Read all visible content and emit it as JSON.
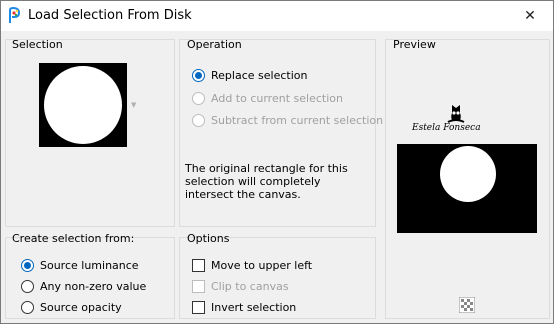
{
  "window": {
    "title": "Load Selection From Disk",
    "icon": "app-icon",
    "close_symbol": "✕"
  },
  "selection": {
    "label": "Selection",
    "dropdown_icon": "chevron-down-icon"
  },
  "operation": {
    "label": "Operation",
    "options": [
      {
        "label": "Replace selection",
        "checked": true,
        "enabled": true
      },
      {
        "label": "Add to current selection",
        "checked": false,
        "enabled": false
      },
      {
        "label": "Subtract from current selection",
        "checked": false,
        "enabled": false
      }
    ],
    "info": "The original rectangle for this selection will completely intersect the canvas."
  },
  "preview": {
    "label": "Preview",
    "watermark": "Estela Fonseca",
    "zoom_icon": "checker-icon"
  },
  "create_from": {
    "label": "Create selection from:",
    "options": [
      {
        "label": "Source luminance",
        "checked": true
      },
      {
        "label": "Any non-zero value",
        "checked": false
      },
      {
        "label": "Source opacity",
        "checked": false
      }
    ]
  },
  "options": {
    "label": "Options",
    "items": [
      {
        "label": "Move to upper left",
        "checked": false,
        "enabled": true
      },
      {
        "label": "Clip to canvas",
        "checked": false,
        "enabled": false
      },
      {
        "label": "Invert selection",
        "checked": false,
        "enabled": true
      }
    ]
  },
  "colors": {
    "accent": "#0067c0",
    "background": "#f0f0f0",
    "border": "#dcdcdc"
  }
}
